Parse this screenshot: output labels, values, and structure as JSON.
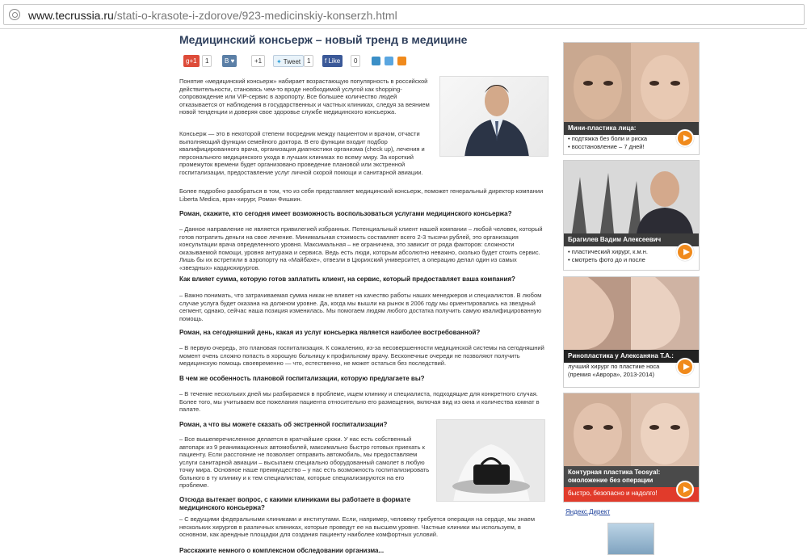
{
  "browser": {
    "url_domain": "www.tecrussia.ru",
    "url_path": "/stati-o-krasote-i-zdorove/923-medicinskiy-konserzh.html"
  },
  "article": {
    "title": "Медицинский консьерж – новый тренд в медицине",
    "share": {
      "gplus_label": "g+1",
      "gplus_count": "1",
      "vk_label": "B",
      "vk_count": "+1",
      "twitter_label": "Tweet",
      "twitter_count": "1",
      "fb_label": "Like",
      "fb_count": "0"
    },
    "paragraphs": [
      "Понятие «медицинский консьерж» набирает возрастающую популярность в российской действительности, становясь чем-то вроде необходимой услугой как shopping-сопровождение или VIP-сервис в аэропорту. Все большее количество людей отказывается от наблюдения в государственных и частных клиниках, следуя за веянием новой тенденции и доверяя свое здоровье службе медицинского консьержа.",
      "Консьерж — это в некоторой степени посредник между пациентом и врачом, отчасти выполняющий функции семейного доктора. В его функции входит подбор квалифицированного врача, организация диагностики организма (check up), лечения и персонального медицинского ухода в лучших клиниках по всему миру. За короткий промежуток времени будет организовано проведение плановой или экстренной госпитализации, предоставление услуг личной скорой помощи и санитарной авиации.",
      "Более подробно разобраться в том, что из себя представляет медицинский консьерж, поможет генеральный директор компании Liberta Medica, врач-хирург, Роман Фишкин."
    ],
    "q1": "Роман, скажите, кто сегодня имеет возможность воспользоваться услугами медицинского консьержа?",
    "a1": "– Данное направление не является привилегией избранных. Потенциальный клиент нашей компании – любой человек, который готов потратить деньги на свое лечение. Минимальная стоимость составляет всего 2-3 тысячи рублей, это организация консультации врача определенного уровня. Максимальная – не ограничена, это зависит от ряда факторов: сложности оказываемой помощи, уровня антуража и сервиса. Ведь есть люди, которым абсолютно неважно, сколько будет стоить сервис. Лишь бы их встретили в аэропорту на «Майбахе», отвезли в Цюрихский университет, а операцию делал один из самых «звездных» кардиохирургов.",
    "q2": "Как влияет сумма, которую готов заплатить клиент, на сервис, который предоставляет ваша компания?",
    "a2": "– Важно понимать, что затрачиваемая сумма никак не влияет на качество работы наших менеджеров и специалистов. В любом случае услуга будет оказана на должном уровне. Да, когда мы вышли на рынок в 2006 году мы ориентировались на звездный сегмент, однако, сейчас наша позиция изменилась. Мы помогаем людям любого достатка получить самую квалифицированную помощь.",
    "q3": "Роман, на сегодняшний день, какая из услуг консьержа является наиболее востребованной?",
    "a3": "– В первую очередь, это плановая госпитализация. К сожалению, из-за несовершенности медицинской системы на сегодняшний момент очень сложно попасть в хорошую больницу к профильному врачу. Бесконечные очереди не позволяют получить медицинскую помощь своевременно — что, естественно, не может остаться без последствий.",
    "q4": "В чем же особенность плановой госпитализации, которую предлагаете вы?",
    "a4": "– В течение нескольких дней мы разбираемся в проблеме, ищем клинику и специалиста, подходящие для конкретного случая. Более того, мы учитываем все пожелания пациента относительно его размещения, включая вид из окна и количества комнат в палате.",
    "q5": "Роман, а что вы можете сказать об экстренной госпитализации?",
    "a5": "– Все вышеперечисленное делается в кратчайшие сроки. У нас есть собственный автопарк из 9 реанимационных автомобилей, максимально быстро готовых приехать к пациенту. Если расстояние не позволяет отправить автомобиль, мы предоставляем услуги санитарной авиации – высылаем специально оборудованный самолет в любую точку мира. Основное наше преимущество – у нас есть возможность госпитализировать больного в ту клинику и к тем специалистам, которые специализируются на его проблеме.",
    "q6": "Отсюда вытекает вопрос, с какими клиниками вы работаете в формате медицинского консьержа?",
    "a6": "– С ведущими федеральными клиниками и институтами. Если, например, человеку требуется операция на сердце, мы знаем нескольких хирургов в различных клиниках, которые проведут ее на высшем уровне. Частные клиники мы используем, в основном, как арендные площадки для создания пациенту наиболее комфортных условий.",
    "q7": "Расскажите немного о комплексном обследовании организма..."
  },
  "sidebar": {
    "ad1": {
      "title": "Мини-пластика лица:",
      "line1": "• подтяжка без боли и риска",
      "line2": "• восстановление – 7 дней!"
    },
    "ad2": {
      "title": "Брагилев Вадим Алексеевич",
      "line1": "• пластический хирург, к.м.н.",
      "line2": "• смотреть фото до и после"
    },
    "ad3": {
      "title": "Ринопластика у Алексаняна Т.А.:",
      "line1": "лучший хирург по пластике носа",
      "line2": "(премия «Аврора», 2013-2014)"
    },
    "ad4": {
      "title": "Контурная пластика Teosyal:",
      "title2": "омоложение без операции",
      "line1": "быстро, безопасно и надолго!"
    },
    "yandex_direct": "Яндекс.Директ"
  },
  "colors": {
    "title": "#2e3f5c",
    "accent": "#f08a1c",
    "ad4_band": "#e13b2b"
  }
}
